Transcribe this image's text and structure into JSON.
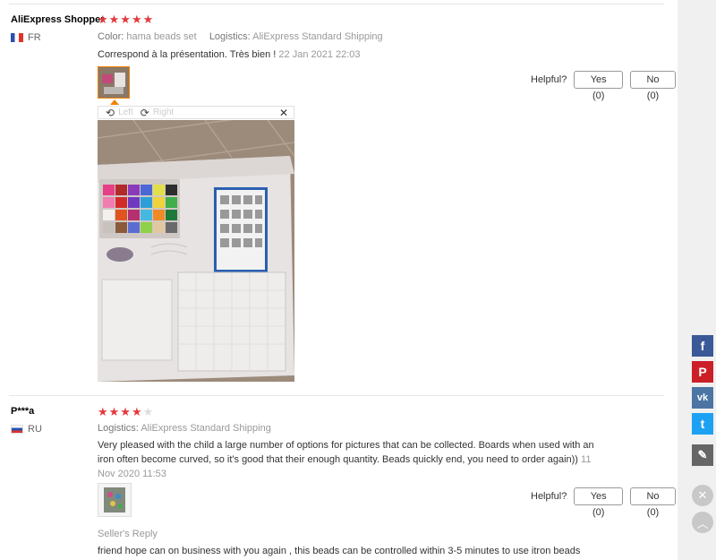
{
  "reviews": [
    {
      "user": "AliExpress Shopper",
      "country": "FR",
      "stars": "★★★★★",
      "color_label": "Color:",
      "color_value": "hama beads set",
      "logistics_label": "Logistics:",
      "logistics_value": "AliExpress Standard Shipping",
      "text": "Correspond à la présentation. Très bien !",
      "date": "22 Jan 2021 22:03"
    },
    {
      "user": "P***a",
      "country": "RU",
      "stars_on": "★★★★",
      "stars_off": "★",
      "logistics_label": "Logistics:",
      "logistics_value": "AliExpress Standard Shipping",
      "text": "Very pleased with the child a large number of options for pictures that can be collected. Boards when used with an iron often become curved, so it's good that their enough quantity. Beads quickly end, you need to order again))",
      "date": "11 Nov 2020 11:53",
      "seller_reply_label": "Seller's Reply",
      "seller_reply_text": "friend hope can on business with you again , this beads can be controlled within 3-5 minutes to use itron beads"
    }
  ],
  "helpful": {
    "label": "Helpful?",
    "yes": "Yes (0)",
    "no": "No (0)"
  },
  "viewer": {
    "left": "Left",
    "right": "Right",
    "close": "✕"
  },
  "share": {
    "facebook": "f",
    "pinterest": "P",
    "vk": "vk",
    "twitter": "t",
    "edit": "✎",
    "close": "✕",
    "up": "︿"
  }
}
